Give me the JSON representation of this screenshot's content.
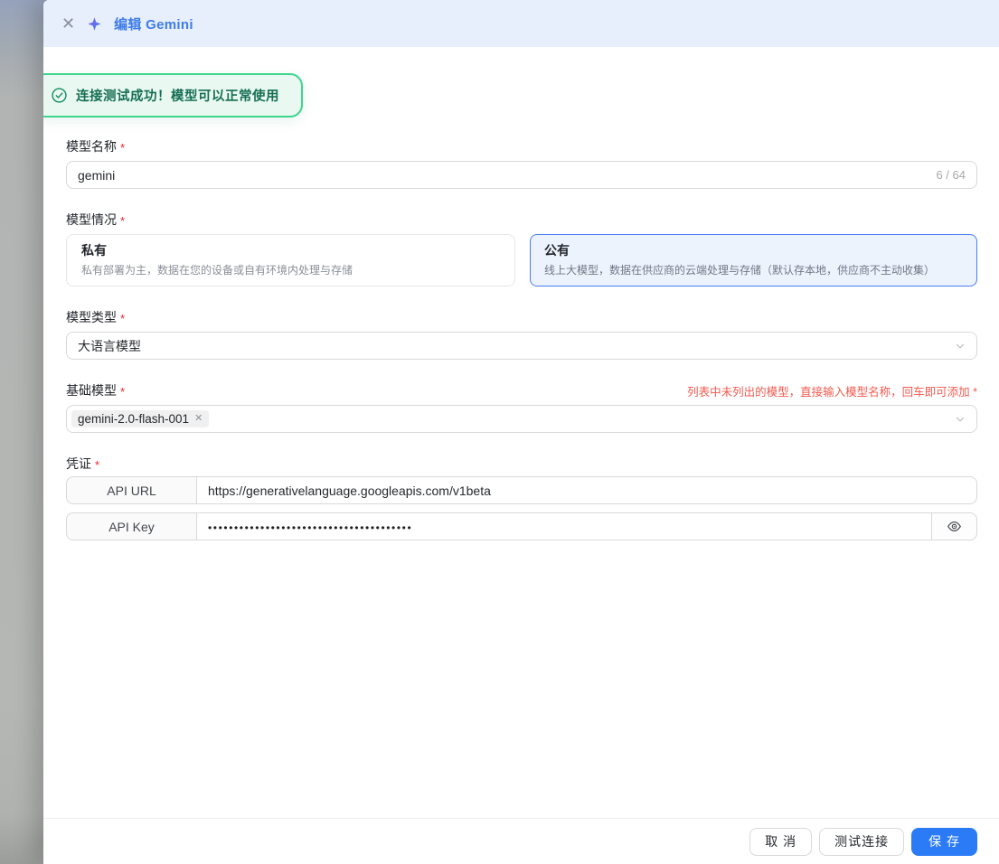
{
  "drawer": {
    "title": "编辑 Gemini"
  },
  "toast": {
    "message": "连接测试成功！模型可以正常使用"
  },
  "required_mark": "*",
  "icons": {
    "close": "✕",
    "tag_remove": "✕"
  },
  "form": {
    "model_name": {
      "label": "模型名称",
      "value": "gemini",
      "counter": "6 / 64"
    },
    "model_scope": {
      "label": "模型情况",
      "options": [
        {
          "title": "私有",
          "description": "私有部署为主，数据在您的设备或自有环境内处理与存储",
          "selected": false
        },
        {
          "title": "公有",
          "description": "线上大模型，数据在供应商的云端处理与存储（默认存本地，供应商不主动收集）",
          "selected": true
        }
      ]
    },
    "model_type": {
      "label": "模型类型",
      "value": "大语言模型"
    },
    "base_model": {
      "label": "基础模型",
      "hint": "列表中未列出的模型，直接输入模型名称，回车即可添加 *",
      "tag": "gemini-2.0-flash-001"
    },
    "credentials": {
      "label": "凭证",
      "api_url": {
        "label": "API URL",
        "value": "https://generativelanguage.googleapis.com/v1beta"
      },
      "api_key": {
        "label": "API Key",
        "value": "•••••••••••••••••••••••••••••••••••••••"
      }
    }
  },
  "footer": {
    "cancel": "取 消",
    "test_connection": "测试连接",
    "save": "保 存"
  },
  "colors": {
    "primary": "#2b7bf6",
    "header_bg": "#e7eefc",
    "title_blue": "#3f7ce8",
    "success_border": "#3dd68c",
    "success_bg": "#e9f9f1",
    "success_text": "#166e54",
    "danger": "#f25a4f",
    "selected_card_border": "#4a7df0",
    "selected_card_bg": "#edf3fd"
  }
}
